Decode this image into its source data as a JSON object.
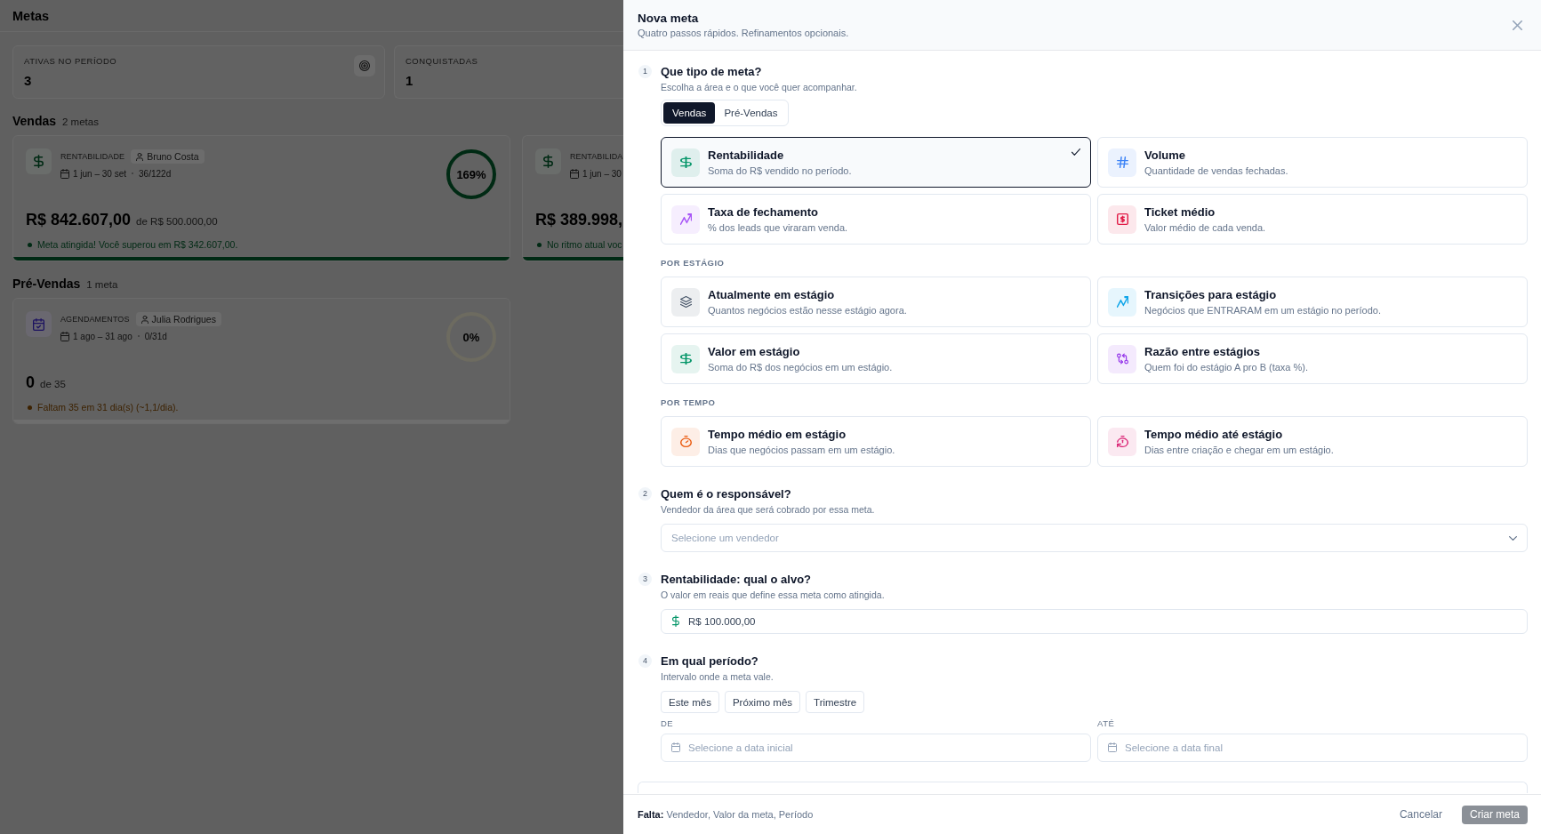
{
  "page": {
    "title": "Metas",
    "stats": [
      {
        "label": "ATIVAS NO PERÍODO",
        "value": "3"
      },
      {
        "label": "CONQUISTADAS",
        "value": "1"
      }
    ],
    "sections": [
      {
        "title": "Vendas",
        "count": "2 metas",
        "goals": [
          {
            "kind": "revenue",
            "type": "RENTABILIDADE",
            "owner": "Bruno Costa",
            "period": "1 jun – 30 set",
            "days": "36/122d",
            "value": "R$ 842.607,00",
            "target": "de R$ 500.000,00",
            "percent": "169%",
            "level": 1,
            "status": "Meta atingida! Você superou em R$ 342.607,00.",
            "color": "#002a14"
          },
          {
            "kind": "revenue",
            "type": "RENTABILIDA",
            "period": "1 jun – 30",
            "value": "R$ 389.998,",
            "level": 1,
            "status": "No ritmo atual voc",
            "color": "#002a14"
          }
        ]
      },
      {
        "title": "Pré-Vendas",
        "count": "1 meta",
        "goals": [
          {
            "kind": "appointments",
            "type": "AGENDAMENTOS",
            "owner": "Julia Rodrigues",
            "period": "1 ago – 31 ago",
            "days": "0/31d",
            "value": "0",
            "target": "de 35",
            "percent": "0%",
            "level": 0,
            "status": "Faltam 35 em 31 dia(s) (~1,1/dia).",
            "color": "#3d2200"
          }
        ]
      }
    ]
  },
  "drawer": {
    "title": "Nova meta",
    "subtitle": "Quatro passos rápidos. Refinamentos opcionais.",
    "steps": [
      {
        "kind": "type",
        "number": "1",
        "title": "Que tipo de meta?",
        "hint": "Escolha a área e o que você quer acompanhar.",
        "areas": [
          {
            "label": "Vendas",
            "selected": true
          },
          {
            "label": "Pré-Vendas",
            "selected": false
          }
        ],
        "groups": [
          {
            "options": [
              {
                "kind": "dollar",
                "color": "#059669",
                "title": "Rentabilidade",
                "description": "Soma do R$ vendido no período.",
                "selected": true
              },
              {
                "kind": "hash",
                "color": "#3b82f6",
                "title": "Volume",
                "description": "Quantidade de vendas fechadas.",
                "selected": false
              },
              {
                "kind": "trend",
                "color": "#a855f7",
                "title": "Taxa de fechamento",
                "description": "% dos leads que viraram venda.",
                "selected": false
              },
              {
                "kind": "receipt",
                "color": "#e11d48",
                "title": "Ticket médio",
                "description": "Valor médio de cada venda.",
                "selected": false
              }
            ]
          },
          {
            "heading": "POR ESTÁGIO",
            "options": [
              {
                "kind": "layers",
                "color": "#475569",
                "title": "Atualmente em estágio",
                "description": "Quantos negócios estão nesse estágio agora.",
                "selected": false
              },
              {
                "kind": "trend",
                "color": "#0ea5e9",
                "title": "Transições para estágio",
                "description": "Negócios que ENTRARAM em um estágio no período.",
                "selected": false
              },
              {
                "kind": "dollar",
                "color": "#059669",
                "title": "Valor em estágio",
                "description": "Soma do R$ dos negócios em um estágio.",
                "selected": false
              },
              {
                "kind": "swap",
                "color": "#9333ea",
                "title": "Razão entre estágios",
                "description": "Quem foi do estágio A pro B (taxa %).",
                "selected": false
              }
            ]
          },
          {
            "heading": "POR TEMPO",
            "options": [
              {
                "kind": "timer",
                "color": "#ea580c",
                "title": "Tempo médio em estágio",
                "description": "Dias que negócios passam em um estágio.",
                "selected": false
              },
              {
                "kind": "timer-reset",
                "color": "#db2777",
                "title": "Tempo médio até estágio",
                "description": "Dias entre criação e chegar em um estágio.",
                "selected": false
              }
            ]
          }
        ]
      },
      {
        "kind": "select",
        "number": "2",
        "title": "Quem é o responsável?",
        "hint": "Vendedor da área que será cobrado por essa meta.",
        "placeholder": "Selecione um vendedor"
      },
      {
        "kind": "amount",
        "number": "3",
        "title": "Rentabilidade: qual o alvo?",
        "hint": "O valor em reais que define essa meta como atingida.",
        "value": "R$ 100.000,00"
      },
      {
        "kind": "period",
        "number": "4",
        "title": "Em qual período?",
        "hint": "Intervalo onde a meta vale.",
        "presets": [
          {
            "label": "Este mês",
            "selected": false
          },
          {
            "label": "Próximo mês",
            "selected": false
          },
          {
            "label": "Trimestre",
            "selected": false
          }
        ],
        "dates": [
          {
            "label": "DE",
            "placeholder": "Selecione a data inicial"
          },
          {
            "label": "ATÉ",
            "placeholder": "Selecione a data final"
          }
        ]
      }
    ],
    "footer": {
      "missing": "**Falta:** Vendedor, Valor da meta, Período",
      "cancel": "Cancelar",
      "submit": {
        "label": "Criar meta",
        "disabled": true
      }
    }
  }
}
